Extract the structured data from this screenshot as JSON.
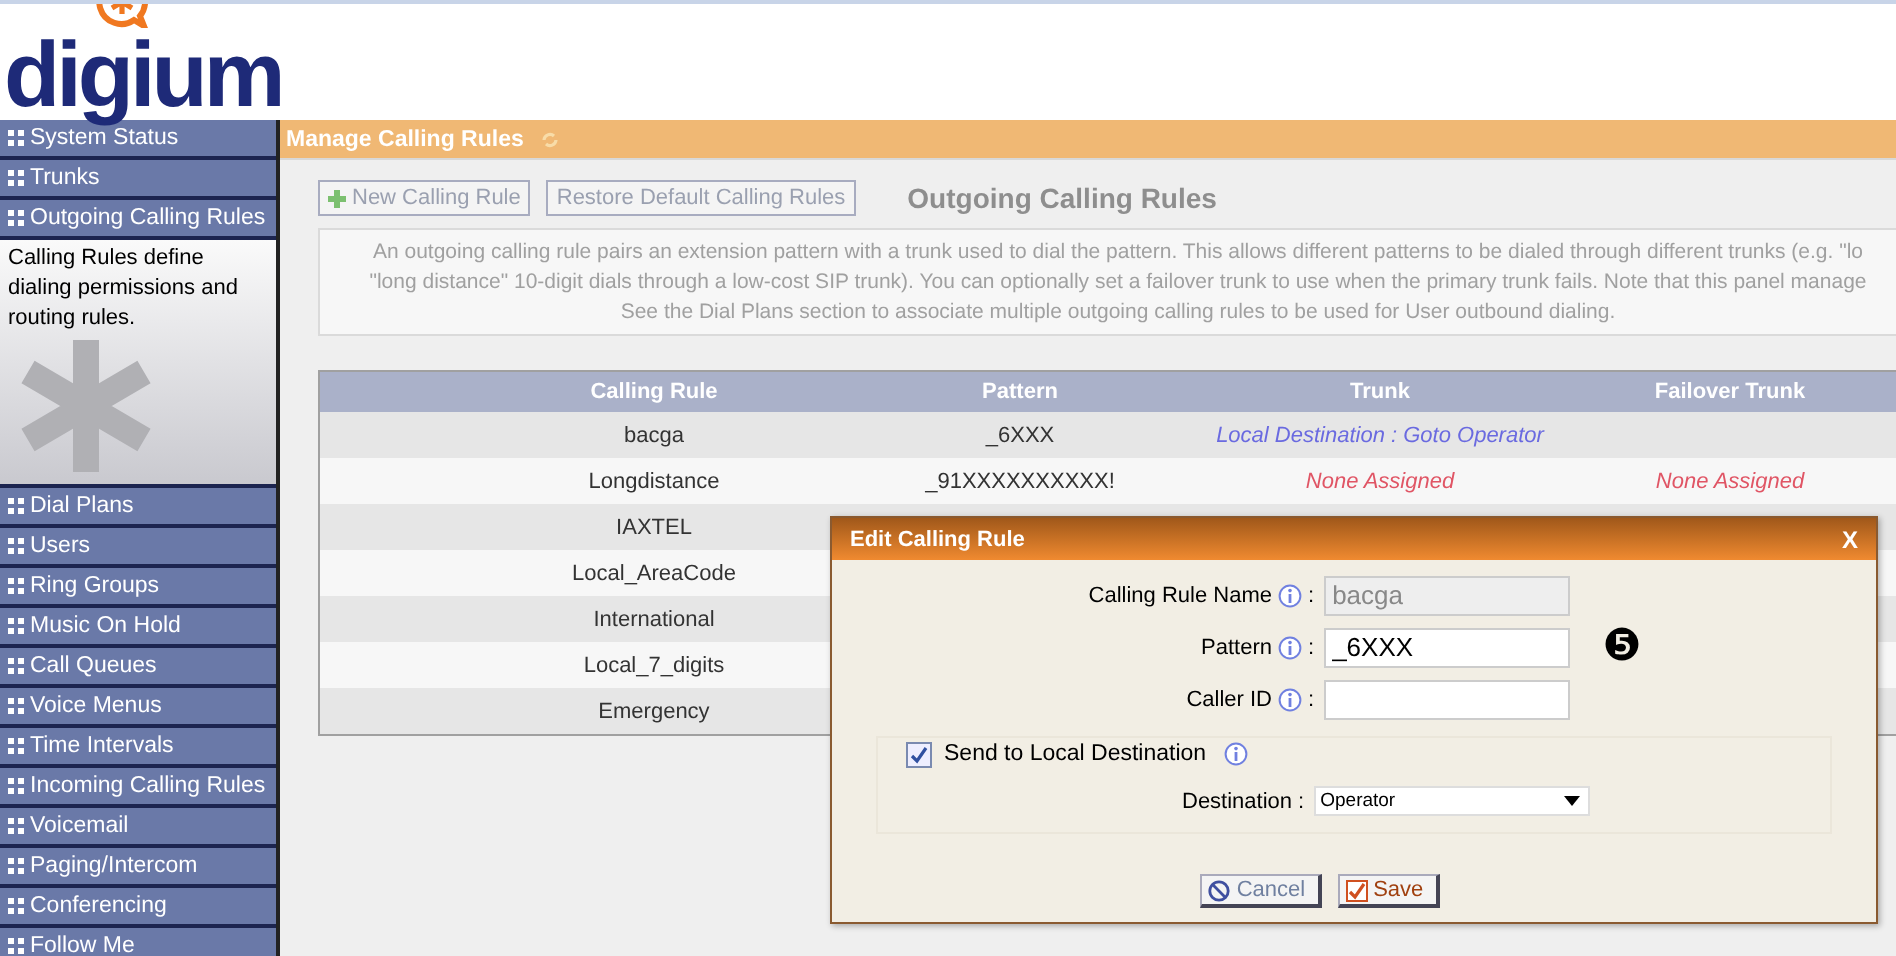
{
  "logo": {
    "text": "digium"
  },
  "sidebar": {
    "items": [
      {
        "label": "System Status"
      },
      {
        "label": "Trunks"
      },
      {
        "label": "Outgoing Calling Rules",
        "description": "Calling Rules define dialing permissions and routing rules."
      },
      {
        "label": "Dial Plans"
      },
      {
        "label": "Users"
      },
      {
        "label": "Ring Groups"
      },
      {
        "label": "Music On Hold"
      },
      {
        "label": "Call Queues"
      },
      {
        "label": "Voice Menus"
      },
      {
        "label": "Time Intervals"
      },
      {
        "label": "Incoming Calling Rules"
      },
      {
        "label": "Voicemail"
      },
      {
        "label": "Paging/Intercom"
      },
      {
        "label": "Conferencing"
      },
      {
        "label": "Follow Me"
      }
    ]
  },
  "page_header": {
    "title": "Manage Calling Rules"
  },
  "toolbar": {
    "buttons": [
      {
        "label": "New Calling Rule",
        "kind": "add"
      },
      {
        "label": "Restore Default Calling Rules",
        "kind": "plain"
      }
    ],
    "title": "Outgoing Calling Rules"
  },
  "description": {
    "lines": [
      "An outgoing calling rule pairs an extension pattern with a trunk used to dial the pattern. This allows different patterns to be dialed through different trunks (e.g. \"lo",
      "\"long distance\" 10-digit dials through a low-cost SIP trunk). You can optionally set a failover trunk to use when the primary trunk fails. Note that this panel manage",
      "See the Dial Plans section to associate multiple outgoing calling rules to be used for User outbound dialing."
    ]
  },
  "table": {
    "columns": [
      "Calling Rule",
      "Pattern",
      "Trunk",
      "Failover Trunk"
    ],
    "rows": [
      {
        "calling_rule": "bacga",
        "pattern": "_6XXX",
        "trunk": {
          "text": "Local Destination : Goto Operator",
          "kind": "destination"
        }
      },
      {
        "calling_rule": "Longdistance",
        "pattern": "_91XXXXXXXXXX!",
        "trunk": {
          "text": "None Assigned",
          "kind": "none"
        },
        "failover_trunk": {
          "text": "None Assigned",
          "kind": "none"
        }
      },
      {
        "calling_rule": "IAXTEL"
      },
      {
        "calling_rule": "Local_AreaCode"
      },
      {
        "calling_rule": "International"
      },
      {
        "calling_rule": "Local_7_digits"
      },
      {
        "calling_rule": "Emergency"
      }
    ]
  },
  "dialog": {
    "title": "Edit Calling Rule",
    "close": "X",
    "separator": ":",
    "fields": [
      {
        "label": "Calling Rule Name",
        "value": "bacga",
        "disabled": true
      },
      {
        "label": "Pattern",
        "value": "_6XXX",
        "disabled": false,
        "step_badge": "❺"
      },
      {
        "label": "Caller ID",
        "disabled": false
      }
    ],
    "local_destination": {
      "label": "Send to Local Destination",
      "checked": true,
      "destination_label": "Destination",
      "destination_value": "Operator"
    },
    "buttons": [
      {
        "label": "Cancel",
        "kind": "cancel"
      },
      {
        "label": "Save",
        "kind": "save"
      }
    ]
  }
}
